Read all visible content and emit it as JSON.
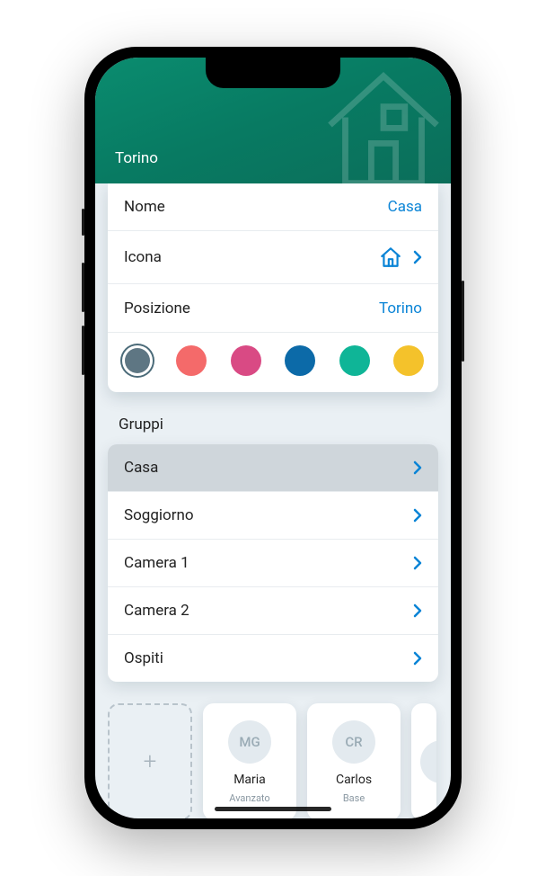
{
  "header": {
    "title": "Torino"
  },
  "settings": {
    "name_label": "Nome",
    "name_value": "Casa",
    "icon_label": "Icona",
    "position_label": "Posizione",
    "position_value": "Torino"
  },
  "colors": [
    {
      "hex": "#5e7683",
      "selected": true
    },
    {
      "hex": "#f46a6a",
      "selected": false
    },
    {
      "hex": "#d94a84",
      "selected": false
    },
    {
      "hex": "#0c6aa8",
      "selected": false
    },
    {
      "hex": "#0fb597",
      "selected": false
    },
    {
      "hex": "#f4c22b",
      "selected": false
    }
  ],
  "groups": {
    "title": "Gruppi",
    "items": [
      {
        "label": "Casa",
        "active": true
      },
      {
        "label": "Soggiorno",
        "active": false
      },
      {
        "label": "Camera 1",
        "active": false
      },
      {
        "label": "Camera 2",
        "active": false
      },
      {
        "label": "Ospiti",
        "active": false
      }
    ]
  },
  "users": {
    "add_label": "+",
    "items": [
      {
        "initials": "MG",
        "name": "Maria",
        "role": "Avanzato"
      },
      {
        "initials": "CR",
        "name": "Carlos",
        "role": "Base"
      }
    ]
  }
}
